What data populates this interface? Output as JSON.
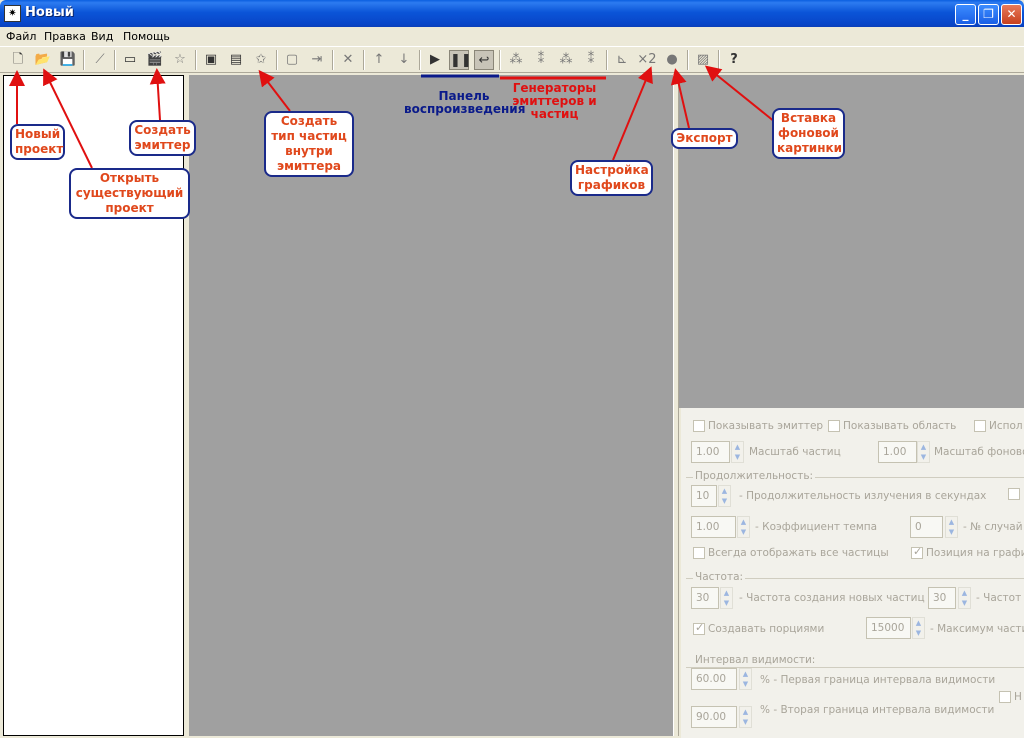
{
  "window": {
    "title": "Новый",
    "min_icon": "minimize-icon",
    "max_icon": "restore-icon",
    "close_icon": "close-icon"
  },
  "menu": {
    "items": [
      "Файл",
      "Правка",
      "Вид",
      "Помощь"
    ]
  },
  "toolbar": {
    "icons": [
      "new-file-icon",
      "open-folder-icon",
      "save-icon",
      "graph-icon",
      "folder-icon",
      "clapper-icon",
      "star-icon",
      "add-emitter-icon",
      "add-emitter-icon-2",
      "add-star-icon",
      "emitter-box-icon",
      "emitter-move-icon",
      "delete-icon",
      "up-arrow-icon",
      "down-arrow-icon",
      "play-icon",
      "pause-icon",
      "loop-icon",
      "generator-icon-1",
      "generator-icon-2",
      "generator-icon-3",
      "generator-icon-4",
      "graph-settings-icon",
      "x2-icon",
      "export-icon",
      "background-image-icon",
      "help-icon"
    ],
    "x2_label": "×2",
    "help_label": "?"
  },
  "settings": {
    "show_emitter": "Показывать эмиттер",
    "show_area": "Показывать область",
    "use_label": "Испол",
    "particle_scale_value": "1.00",
    "particle_scale_label": "Масштаб частиц",
    "bg_scale_value": "1.00",
    "bg_scale_label": "Масштаб фоново",
    "duration_group": "Продолжительность:",
    "emit_duration_value": "10",
    "emit_duration_label": "- Продолжительность излучения в секундах",
    "tempo_value": "1.00",
    "tempo_label": "- Коэффициент темпа",
    "random_value": "0",
    "random_label": "- № случай",
    "show_all": "Всегда отображать все частицы",
    "graph_position": "Позиция на графи",
    "frequency_group": "Частота:",
    "freq_value": "30",
    "freq_label": "- Частота создания новых частиц",
    "freq2_value": "30",
    "freq2_label": "- Частот",
    "portions": "Создавать порциями",
    "max_value": "15000",
    "max_label": "- Максимум части",
    "visibility_group": "Интервал видимости:",
    "vis1_value": "60.00",
    "vis1_label": "% - Первая граница интервала видимости",
    "vis2_value": "90.00",
    "vis2_label": "% - Вторая граница интервала видимости",
    "h_label": "Н"
  },
  "annotations": {
    "new_project": "Новый\nпроект",
    "open_project": "Открыть\nсуществующий\nпроект",
    "create_emitter": "Создать\nэмиттер",
    "create_particle_type": "Создать\nтип частиц\nвнутри\nэмиттера",
    "playback_panel": "Панель\nвоспроизведения",
    "generators": "Генераторы\nэмиттеров и частиц",
    "graph_settings": "Настройка\nграфиков",
    "export": "Экспорт",
    "insert_background": "Вставка\nфоновой\nкартинки",
    "callout_color": "#e0481c",
    "playback_color": "#0a1a8a",
    "generators_color": "#e01010",
    "arrow_color": "#e01010"
  }
}
